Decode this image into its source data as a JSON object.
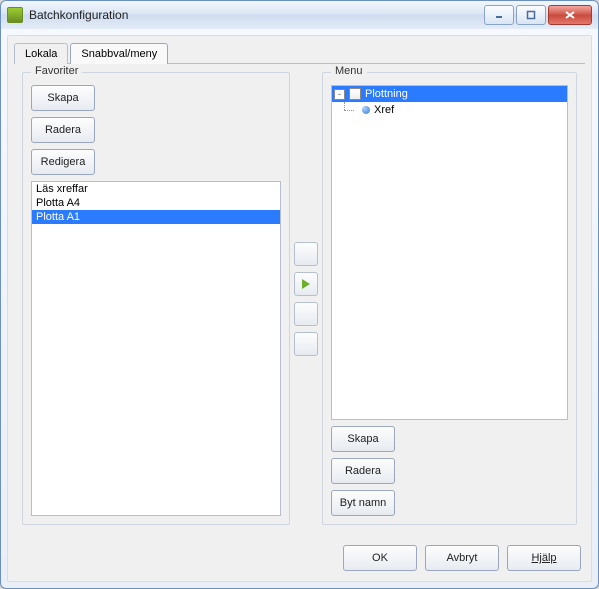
{
  "window": {
    "title": "Batchkonfiguration"
  },
  "tabs": [
    {
      "id": "lokala",
      "label": "Lokala",
      "active": false
    },
    {
      "id": "snabbval",
      "label": "Snabbval/meny",
      "active": true
    }
  ],
  "favoriter": {
    "legend": "Favoriter",
    "buttons": {
      "skapa": "Skapa",
      "radera": "Radera",
      "redigera": "Redigera"
    },
    "items": [
      {
        "label": "Läs xreffar",
        "selected": false
      },
      {
        "label": "Plotta A4",
        "selected": false
      },
      {
        "label": "Plotta A1",
        "selected": true
      }
    ]
  },
  "menu": {
    "legend": "Menu",
    "buttons": {
      "skapa": "Skapa",
      "radera": "Radera",
      "byt_namn": "Byt namn"
    },
    "tree": [
      {
        "label": "Plottning",
        "expanded": true,
        "selected": true,
        "children": [
          {
            "label": "Xref",
            "selected": false
          }
        ]
      }
    ]
  },
  "footer": {
    "ok": "OK",
    "avbryt": "Avbryt",
    "hjalp": "Hjälp"
  }
}
